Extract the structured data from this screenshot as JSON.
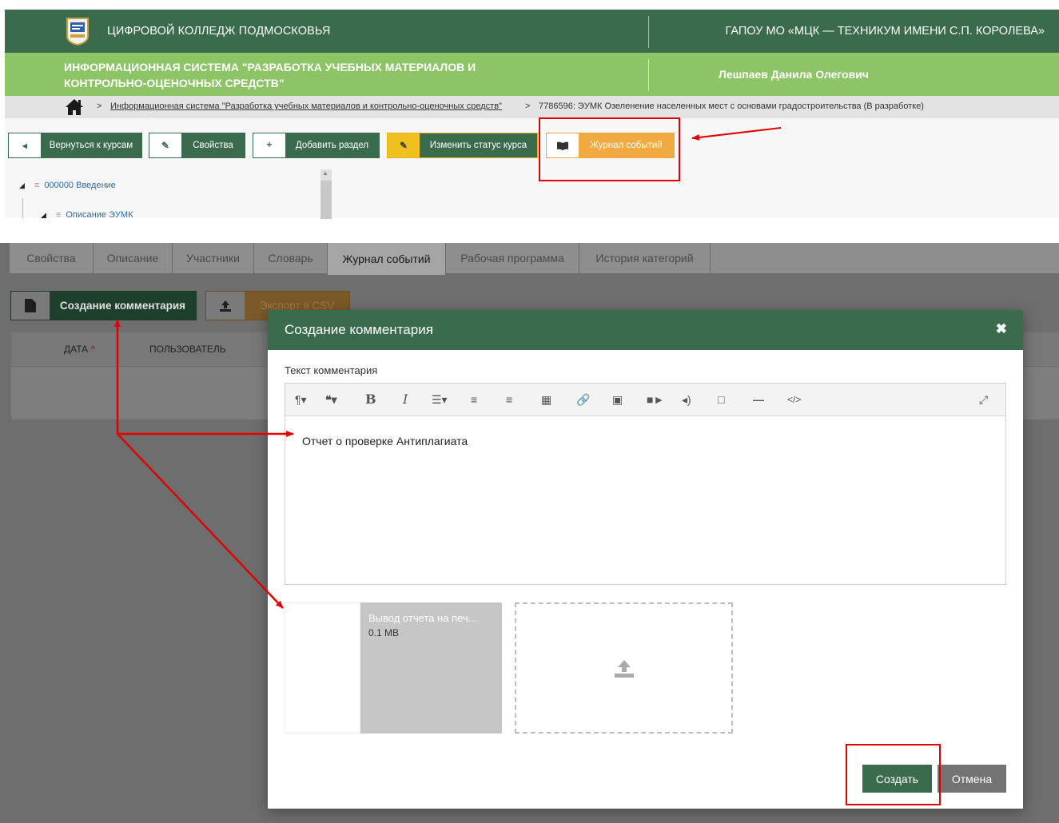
{
  "header": {
    "college_name": "ЦИФРОВОЙ КОЛЛЕДЖ ПОДМОСКОВЬЯ",
    "org_name": "ГАПОУ МО «МЦК — ТЕХНИКУМ ИМЕНИ С.П. КОРОЛЕВА»"
  },
  "subheader": {
    "system_title": "ИНФОРМАЦИОННАЯ СИСТЕМА \"РАЗРАБОТКА УЧЕБНЫХ МАТЕРИАЛОВ И КОНТРОЛЬНО-ОЦЕНОЧНЫХ СРЕДСТВ\"",
    "user_name": "Лешпаев Данила Олегович"
  },
  "breadcrumb": {
    "separator": ">",
    "link": "Информационная система \"Разработка учебных материалов и контрольно-оценочных средств\"",
    "current": "7786596: ЭУМК Озеленение населенных мест с основами градостроительства (В разработке)"
  },
  "toolbar": {
    "back_label": "Вернуться к курсам",
    "properties_label": "Свойства",
    "add_section_label": "Добавить раздел",
    "change_status_label": "Изменить статус курса",
    "event_log_label": "Журнал событий"
  },
  "tree": {
    "item1": "000000 Введение",
    "item2": "Описание ЭУМК"
  },
  "tabs": [
    {
      "label": "Свойства"
    },
    {
      "label": "Описание"
    },
    {
      "label": "Участники"
    },
    {
      "label": "Словарь"
    },
    {
      "label": "Журнал событий"
    },
    {
      "label": "Рабочая программа"
    },
    {
      "label": "История категорий"
    }
  ],
  "actions": {
    "create_comment_label": "Создание комментария",
    "export_csv_label": "Экспорт в CSV"
  },
  "table": {
    "col_date": "ДАТА",
    "col_user": "ПОЛЬЗОВАТЕЛЬ"
  },
  "modal": {
    "title": "Создание комментария",
    "field_label": "Текст комментария",
    "content": "Отчет о проверке Антиплагиата",
    "file_name": "Вывод отчета на печ...",
    "file_size": "0.1 MB",
    "create_label": "Создать",
    "cancel_label": "Отмена"
  },
  "colors": {
    "primary_green": "#3a6b4c",
    "light_green": "#8cc466",
    "accent_orange": "#f1aa42",
    "accent_yellow": "#f0c020",
    "annotation_red": "#e00000"
  }
}
